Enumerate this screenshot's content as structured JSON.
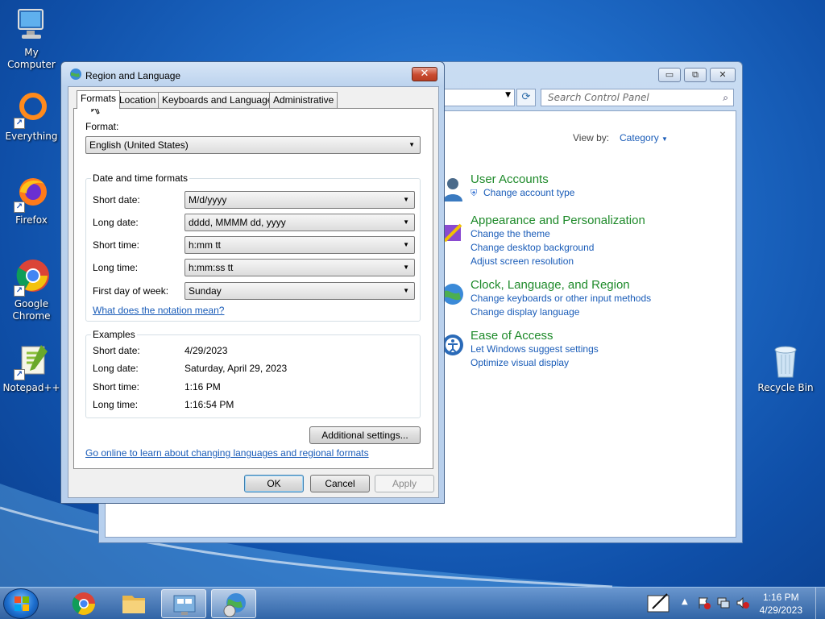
{
  "desktop": {
    "icons": [
      {
        "label": "My Computer"
      },
      {
        "label": "Everything"
      },
      {
        "label": "Firefox"
      },
      {
        "label": "Google Chrome"
      },
      {
        "label": "Notepad++"
      },
      {
        "label": "Recycle Bin"
      }
    ]
  },
  "control_panel": {
    "search_placeholder": "Search Control Panel",
    "view_by_label": "View by:",
    "view_by_value": "Category",
    "categories": [
      {
        "title": "User Accounts",
        "links": [
          "Change account type"
        ]
      },
      {
        "title": "Appearance and Personalization",
        "links": [
          "Change the theme",
          "Change desktop background",
          "Adjust screen resolution"
        ]
      },
      {
        "title": "Clock, Language, and Region",
        "links": [
          "Change keyboards or other input methods",
          "Change display language"
        ]
      },
      {
        "title": "Ease of Access",
        "links": [
          "Let Windows suggest settings",
          "Optimize visual display"
        ]
      }
    ]
  },
  "dialog": {
    "title": "Region and Language",
    "close_glyph": "✕",
    "tabs": [
      "Formats",
      "Location",
      "Keyboards and Languages",
      "Administrative"
    ],
    "format_label": "Format:",
    "format_value": "English (United States)",
    "date_time_group": "Date and time formats",
    "fields": [
      {
        "label": "Short date:",
        "value": "M/d/yyyy"
      },
      {
        "label": "Long date:",
        "value": "dddd, MMMM dd, yyyy"
      },
      {
        "label": "Short time:",
        "value": "h:mm tt"
      },
      {
        "label": "Long time:",
        "value": "h:mm:ss tt"
      },
      {
        "label": "First day of week:",
        "value": "Sunday"
      }
    ],
    "notation_link": "What does the notation mean?",
    "examples_group": "Examples",
    "examples": [
      {
        "label": "Short date:",
        "value": "4/29/2023"
      },
      {
        "label": "Long date:",
        "value": "Saturday, April 29, 2023"
      },
      {
        "label": "Short time:",
        "value": "1:16 PM"
      },
      {
        "label": "Long time:",
        "value": "1:16:54 PM"
      }
    ],
    "additional_settings": "Additional settings...",
    "online_link": "Go online to learn about changing languages and regional formats",
    "ok": "OK",
    "cancel": "Cancel",
    "apply": "Apply"
  },
  "taskbar": {
    "time": "1:16 PM",
    "date": "4/29/2023"
  },
  "colors": {
    "link": "#1a5cb8",
    "category_title": "#1e8a2a",
    "desktop": "#1f6cc8"
  }
}
